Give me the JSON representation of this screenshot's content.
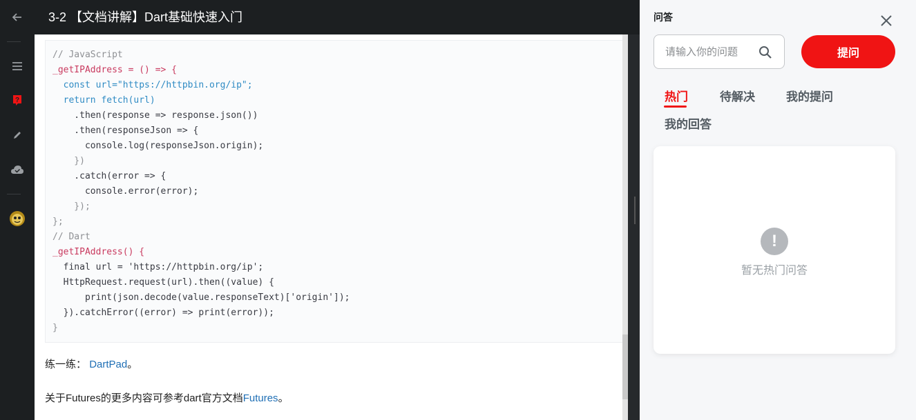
{
  "header": {
    "title": "3-2 【文档讲解】Dart基础快速入门",
    "back_icon": "back-arrow-icon"
  },
  "rail": {
    "items": [
      {
        "name": "menu",
        "icon": "menu-icon"
      },
      {
        "name": "qa",
        "icon": "question-icon",
        "color": "#f01414"
      },
      {
        "name": "notes",
        "icon": "pencil-icon"
      },
      {
        "name": "cloud",
        "icon": "cloud-icon"
      },
      {
        "name": "avatar",
        "icon": "avatar-icon"
      }
    ]
  },
  "code": {
    "lines": [
      "// JavaScript",
      "_getIPAddress = () => {",
      "  const url=\"https://httpbin.org/ip\";",
      "  return fetch(url)",
      "    .then(response => response.json())",
      "    .then(responseJson => {",
      "      console.log(responseJson.origin);",
      "    })",
      "    .catch(error => {",
      "      console.error(error);",
      "    });",
      "};",
      "// Dart",
      "_getIPAddress() {",
      "  final url = 'https://httpbin.org/ip';",
      "  HttpRequest.request(url).then((value) {",
      "      print(json.decode(value.responseText)['origin']);",
      "  }).catchError((error) => print(error));",
      "}"
    ]
  },
  "doc": {
    "practice_prefix": "练一练：",
    "practice_link": "DartPad",
    "practice_suffix": "。",
    "futures_prefix": "关于Futures的更多内容可参考dart官方文档",
    "futures_link": "Futures",
    "futures_suffix": "。"
  },
  "panel": {
    "title": "问答",
    "search_placeholder": "请输入你的问题",
    "ask_label": "提问",
    "tabs": [
      "热门",
      "待解决",
      "我的提问",
      "我的回答"
    ],
    "active_tab": "热门",
    "empty_icon": "!",
    "empty_text": "暂无热门问答"
  },
  "colors": {
    "accent": "#f01414",
    "link": "#1f6fb5",
    "dark_bg": "#1c1f21"
  }
}
